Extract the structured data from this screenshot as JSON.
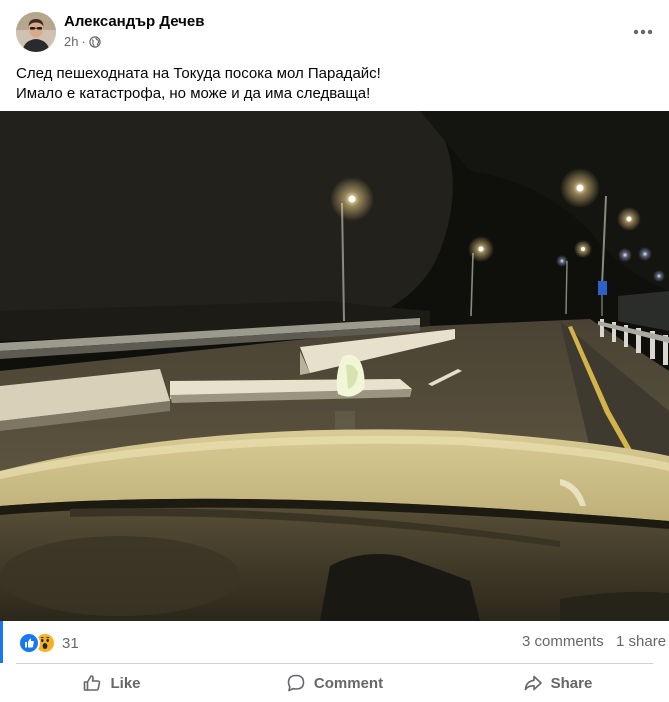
{
  "post": {
    "author": "Александър Дечев",
    "time": "2h",
    "privacy_icon": "globe-icon",
    "more_icon": "more-options-icon",
    "text_lines": [
      "След пешеходната на Токуда посока мол Парадайс!",
      "Имало е катастрофа, но може и да има следваща!"
    ]
  },
  "stats": {
    "reactions": [
      "like-reaction-icon",
      "wow-reaction-icon"
    ],
    "reaction_count": "31",
    "comments": "3 comments",
    "shares": "1 share"
  },
  "actions": {
    "like": "Like",
    "comment": "Comment",
    "share": "Share"
  },
  "colors": {
    "accent": "#1877f2",
    "secondary_text": "#65676b",
    "primary_text": "#050505"
  }
}
